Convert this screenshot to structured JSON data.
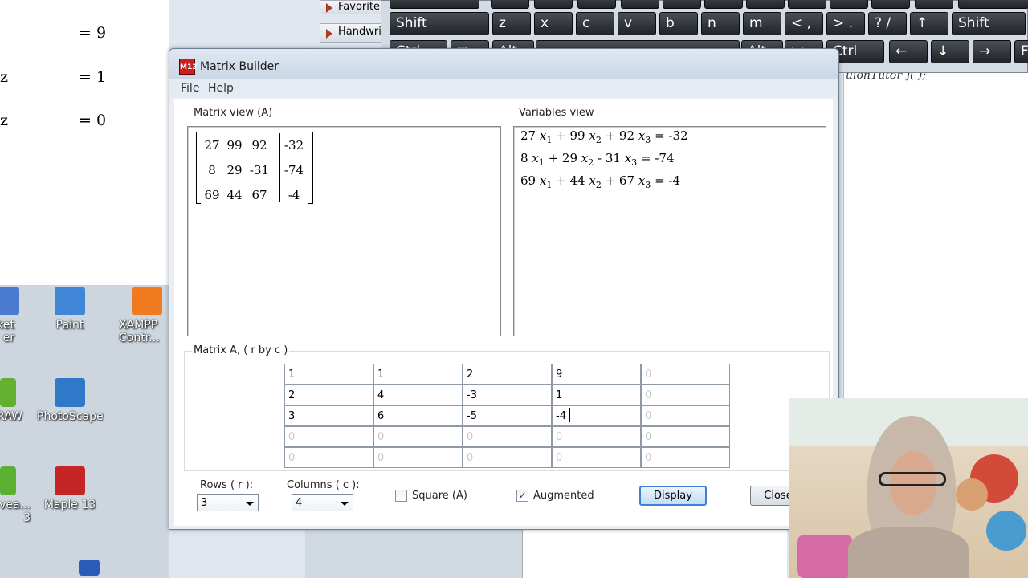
{
  "document": {
    "equations": [
      {
        "left": "",
        "right": "= 9"
      },
      {
        "left": "z",
        "right": "= 1"
      },
      {
        "left": "z",
        "right": "= 0"
      }
    ],
    "right_fragment": "uionTutor ]( );"
  },
  "desktop": {
    "icons": [
      {
        "label": "acket\ner",
        "color": "#4a7bd0"
      },
      {
        "label": "Paint",
        "color": "#3f86d6"
      },
      {
        "label": "XAMPP\nContr...",
        "color": "#f07a20"
      },
      {
        "label": "RAW",
        "color": "#64b030"
      },
      {
        "label": "PhotoScape",
        "color": "#2f79c9"
      },
      {
        "label": "vea...\n3",
        "color": "#5ab030"
      },
      {
        "label": "Maple 13",
        "color": "#c42525"
      }
    ]
  },
  "back_window": {
    "favorites_label": "Favorite",
    "handwriting_label": "Handwri"
  },
  "keyboard": {
    "row1": [
      "Shift",
      "z",
      "x",
      "c",
      "v",
      "b",
      "n",
      "m",
      "<  ,",
      ">  .",
      "?  /",
      "↑",
      "Shift"
    ],
    "row2": [
      "Ctrl",
      "⊞",
      "Alt",
      "",
      "Alt",
      "▤",
      "Ctrl",
      "←",
      "↓",
      "→",
      "Fn"
    ]
  },
  "dialog": {
    "title": "Matrix Builder",
    "icon_text": "M13",
    "menu": [
      "File",
      "Help"
    ],
    "matrix_view_label": "Matrix view (A)",
    "variables_view_label": "Variables view",
    "matrix_view": {
      "rows": [
        [
          "27",
          "99",
          "92",
          "-32"
        ],
        [
          "8",
          "29",
          "-31",
          "-74"
        ],
        [
          "69",
          "44",
          "67",
          "-4"
        ]
      ]
    },
    "variables_view": {
      "equations": [
        {
          "c": [
            "27",
            "+ 99",
            "+ 92"
          ],
          "rhs": "= -32"
        },
        {
          "c": [
            "8",
            "+ 29",
            "- 31"
          ],
          "rhs": "= -74"
        },
        {
          "c": [
            "69",
            "+ 44",
            "+ 67"
          ],
          "rhs": "= -4"
        }
      ],
      "var": "x"
    },
    "grid_label": "Matrix A, ( r by c )",
    "grid": [
      [
        "1",
        "1",
        "2",
        "9",
        "0"
      ],
      [
        "2",
        "4",
        "-3",
        "1",
        "0"
      ],
      [
        "3",
        "6",
        "-5",
        "-4",
        "0"
      ],
      [
        "0",
        "0",
        "0",
        "0",
        "0"
      ],
      [
        "0",
        "0",
        "0",
        "0",
        "0"
      ]
    ],
    "rows_label": "Rows ( r ):",
    "rows_value": "3",
    "columns_label": "Columns ( c ):",
    "columns_value": "4",
    "square_label": "Square (A)",
    "square_checked": false,
    "augmented_label": "Augmented",
    "augmented_checked": true,
    "display_button": "Display",
    "close_button": "Close"
  }
}
